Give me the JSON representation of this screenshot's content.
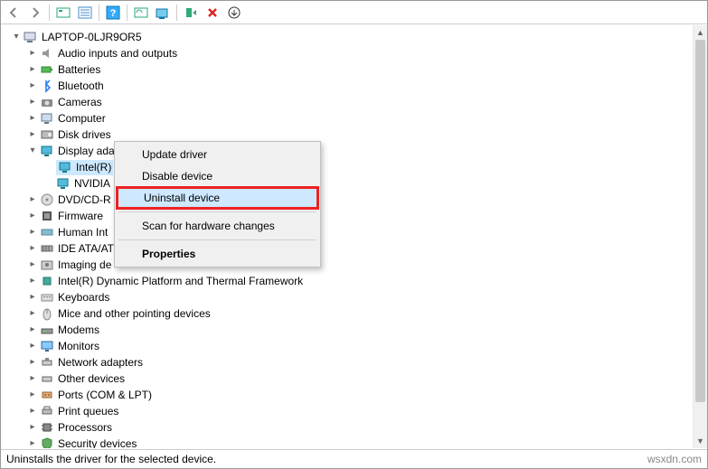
{
  "toolbar": {
    "back": "back-icon",
    "forward": "forward-icon"
  },
  "root": {
    "label": "LAPTOP-0LJR9OR5"
  },
  "categories": [
    {
      "label": "Audio inputs and outputs",
      "expand": "closed"
    },
    {
      "label": "Batteries",
      "expand": "closed"
    },
    {
      "label": "Bluetooth",
      "expand": "closed"
    },
    {
      "label": "Cameras",
      "expand": "closed"
    },
    {
      "label": "Computer",
      "expand": "closed"
    },
    {
      "label": "Disk drives",
      "expand": "closed"
    },
    {
      "label": "Display adapters",
      "expand": "open"
    },
    {
      "label": "DVD/CD-R",
      "expand": "closed"
    },
    {
      "label": "Firmware",
      "expand": "closed"
    },
    {
      "label": "Human Int",
      "expand": "closed"
    },
    {
      "label": "IDE ATA/AT",
      "expand": "closed"
    },
    {
      "label": "Imaging de",
      "expand": "closed"
    },
    {
      "label": "Intel(R) Dynamic Platform and Thermal Framework",
      "expand": "closed"
    },
    {
      "label": "Keyboards",
      "expand": "closed"
    },
    {
      "label": "Mice and other pointing devices",
      "expand": "closed"
    },
    {
      "label": "Modems",
      "expand": "closed"
    },
    {
      "label": "Monitors",
      "expand": "closed"
    },
    {
      "label": "Network adapters",
      "expand": "closed"
    },
    {
      "label": "Other devices",
      "expand": "closed"
    },
    {
      "label": "Ports (COM & LPT)",
      "expand": "closed"
    },
    {
      "label": "Print queues",
      "expand": "closed"
    },
    {
      "label": "Processors",
      "expand": "closed"
    },
    {
      "label": "Security devices",
      "expand": "closed"
    }
  ],
  "display_children": [
    {
      "label": "Intel(R)",
      "selected": true
    },
    {
      "label": "NVIDIA",
      "selected": false
    }
  ],
  "context_menu": {
    "update": "Update driver",
    "disable": "Disable device",
    "uninstall": "Uninstall device",
    "scan": "Scan for hardware changes",
    "properties": "Properties"
  },
  "statusbar": {
    "text": "Uninstalls the driver for the selected device."
  },
  "watermark": "wsxdn.com"
}
